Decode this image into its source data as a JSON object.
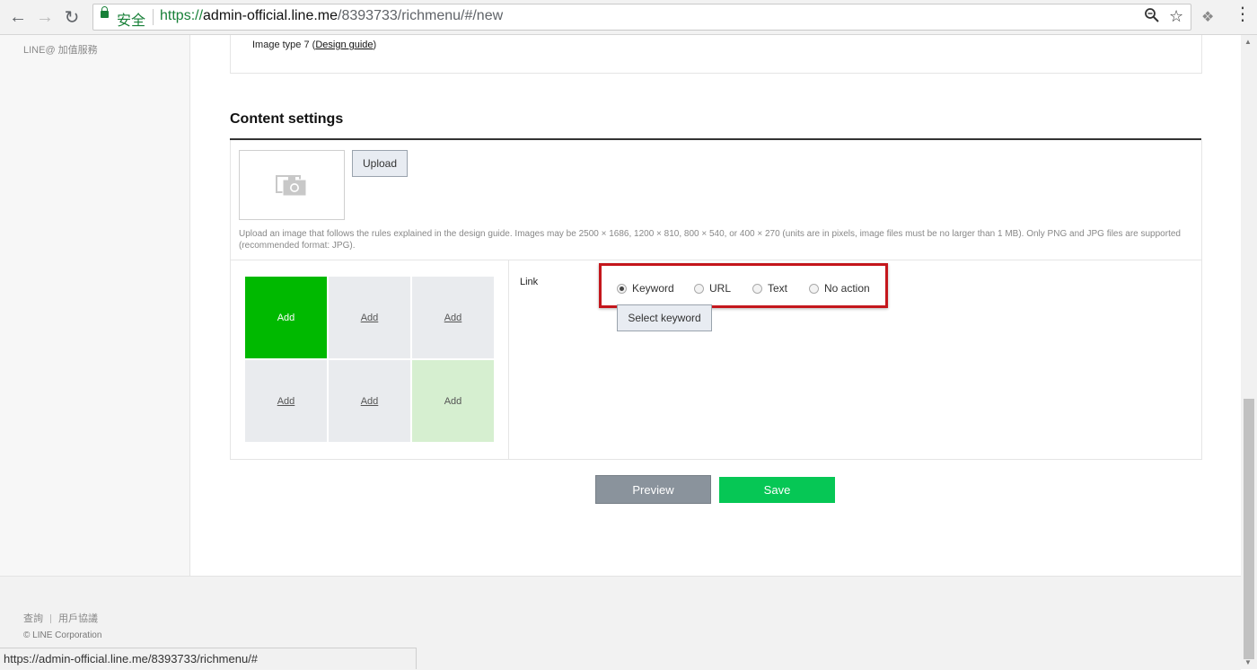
{
  "browser": {
    "secure_label": "安全",
    "url_scheme": "https://",
    "url_host": "admin-official.line.me",
    "url_path": "/8393733/richmenu/#/new",
    "status_url": "https://admin-official.line.me/8393733/richmenu/#"
  },
  "sidebar": {
    "items": [
      {
        "label": "LINE@ 加值服務"
      }
    ]
  },
  "design": {
    "image_type_prefix": "Image type 7 (",
    "design_guide_link": "Design guide",
    "image_type_suffix": ")"
  },
  "content": {
    "title": "Content settings",
    "upload_label": "Upload",
    "upload_note": "Upload an image that follows the rules explained in the design guide. Images may be 2500 × 1686, 1200 × 810, 800 × 540, or 400 × 270 (units are in pixels, image files must be no larger than 1 MB). Only PNG and JPG files are supported (recommended format: JPG).",
    "grid": [
      {
        "label": "Add",
        "state": "active"
      },
      {
        "label": "Add",
        "state": "empty"
      },
      {
        "label": "Add",
        "state": "empty"
      },
      {
        "label": "Add",
        "state": "empty"
      },
      {
        "label": "Add",
        "state": "empty"
      },
      {
        "label": "Add",
        "state": "done"
      }
    ],
    "link_label": "Link",
    "link_options": [
      {
        "label": "Keyword",
        "checked": true
      },
      {
        "label": "URL",
        "checked": false
      },
      {
        "label": "Text",
        "checked": false
      },
      {
        "label": "No action",
        "checked": false
      }
    ],
    "select_keyword_label": "Select keyword"
  },
  "actions": {
    "preview_label": "Preview",
    "save_label": "Save"
  },
  "footer": {
    "links": [
      "查詢",
      "用戶協議"
    ],
    "copyright": "© LINE Corporation"
  },
  "colors": {
    "line_green": "#00b900",
    "save_green": "#06c755",
    "highlight_red": "#c4161c"
  }
}
